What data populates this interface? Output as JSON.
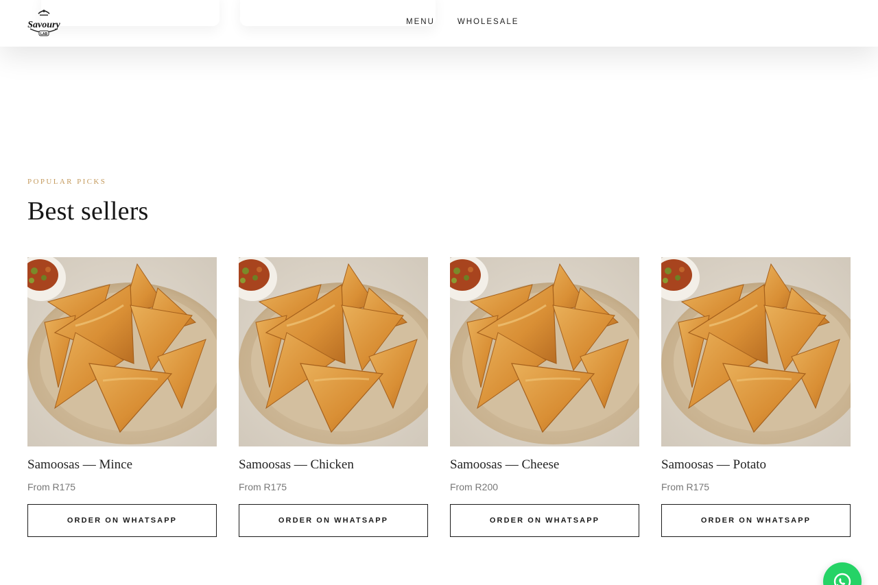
{
  "header": {
    "logo_text": "Savoury",
    "logo_subtext": "LAB",
    "nav": [
      {
        "label": "MENU"
      },
      {
        "label": "WHOLESALE"
      }
    ]
  },
  "section": {
    "eyebrow": "POPULAR PICKS",
    "title": "Best sellers"
  },
  "products": [
    {
      "name": "Samoosas — Mince",
      "price": "From R175",
      "button_label": "ORDER ON WHATSAPP"
    },
    {
      "name": "Samoosas — Chicken",
      "price": "From R175",
      "button_label": "ORDER ON WHATSAPP"
    },
    {
      "name": "Samoosas — Cheese",
      "price": "From R200",
      "button_label": "ORDER ON WHATSAPP"
    },
    {
      "name": "Samoosas — Potato",
      "price": "From R175",
      "button_label": "ORDER ON WHATSAPP"
    }
  ],
  "floating_button": {
    "icon": "whatsapp-icon"
  },
  "colors": {
    "accent": "#c49a5c",
    "whatsapp": "#25d366",
    "text": "#1a1a1a",
    "muted": "#777777"
  }
}
